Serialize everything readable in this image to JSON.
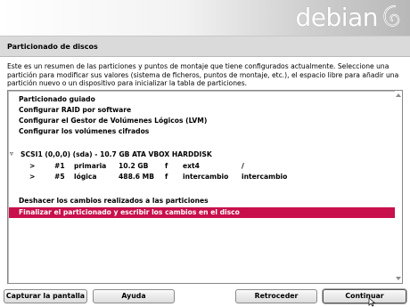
{
  "branding": {
    "logo_text": "debian",
    "logo_icon": "debian-swirl-icon",
    "accent": "#c8114c"
  },
  "window": {
    "title": "Particionado de discos"
  },
  "description": "Este es un resumen de las particiones y puntos de montaje que tiene configurados actualmente. Seleccione una partición para modificar sus valores (sistema de ficheros, puntos de montaje, etc.), el espacio libre para añadir una partición nuevo o un dispositivo para inicializar la tabla de particiones.",
  "menu": {
    "actions": [
      "Particionado guiado",
      "Configurar RAID por software",
      "Configurar el Gestor de Volúmenes Lógicos (LVM)",
      "Configurar los volúmenes cifrados"
    ],
    "disk": {
      "expander": "▿",
      "label": "SCSI1 (0,0,0) (sda) - 10.7 GB ATA VBOX HARDDISK"
    },
    "partitions": [
      {
        "arrow": ">",
        "num": "#1",
        "type": "primaria",
        "size": "10.2 GB",
        "flag": "f",
        "fs": "ext4",
        "mount": "/"
      },
      {
        "arrow": ">",
        "num": "#5",
        "type": "lógica",
        "size": "488.6 MB",
        "flag": "f",
        "fs": "intercambio",
        "mount": "intercambio"
      }
    ],
    "undo": "Deshacer los cambios realizados a las particiones",
    "finish": "Finalizar el particionado y escribir los cambios en el disco"
  },
  "buttons": {
    "screenshot": "Capturar la pantalla",
    "help": "Ayuda",
    "back": "Retroceder",
    "continue": "Continuar"
  }
}
